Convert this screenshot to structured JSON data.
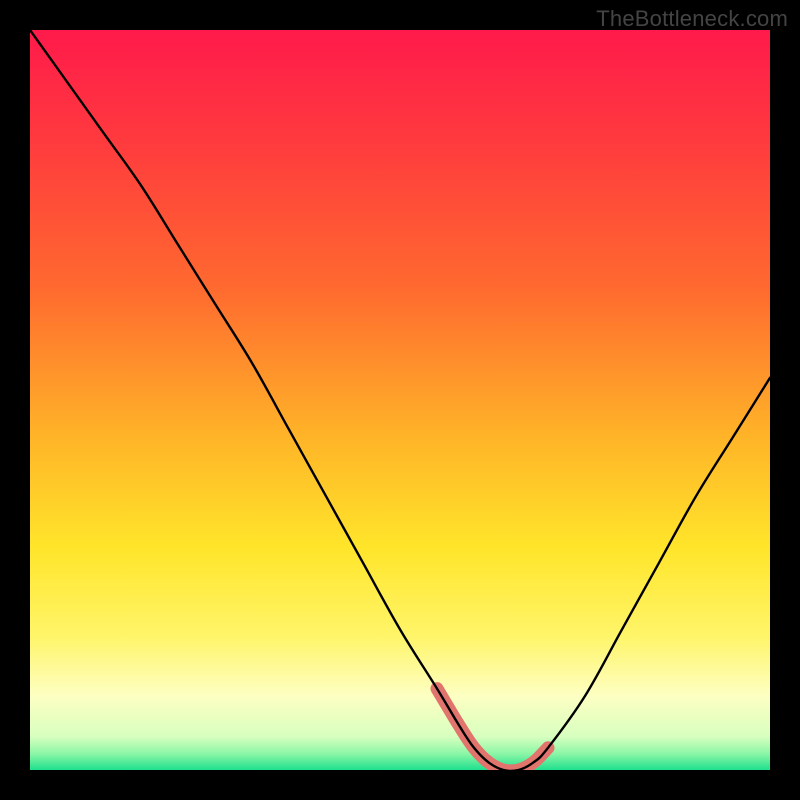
{
  "watermark": "TheBottleneck.com",
  "colors": {
    "frame": "#000000",
    "curve": "#000000",
    "highlight": "#e2746e",
    "gradient_stops": [
      {
        "offset": 0.0,
        "color": "#ff1a4b"
      },
      {
        "offset": 0.15,
        "color": "#ff3a3e"
      },
      {
        "offset": 0.35,
        "color": "#ff6a2f"
      },
      {
        "offset": 0.55,
        "color": "#ffb428"
      },
      {
        "offset": 0.7,
        "color": "#ffe52a"
      },
      {
        "offset": 0.82,
        "color": "#fff56a"
      },
      {
        "offset": 0.9,
        "color": "#fdffc2"
      },
      {
        "offset": 0.955,
        "color": "#d7ffbf"
      },
      {
        "offset": 0.978,
        "color": "#8bf6a6"
      },
      {
        "offset": 1.0,
        "color": "#1fe08e"
      }
    ]
  },
  "chart_data": {
    "type": "line",
    "title": "",
    "xlabel": "",
    "ylabel": "",
    "xlim": [
      0,
      100
    ],
    "ylim": [
      0,
      100
    ],
    "grid": false,
    "legend": false,
    "series": [
      {
        "name": "bottleneck-curve",
        "x": [
          0,
          5,
          10,
          15,
          20,
          25,
          30,
          35,
          40,
          45,
          50,
          55,
          58,
          60,
          62,
          64,
          66,
          68,
          70,
          75,
          80,
          85,
          90,
          95,
          100
        ],
        "values": [
          100,
          93,
          86,
          79,
          71,
          63,
          55,
          46,
          37,
          28,
          19,
          11,
          6,
          3,
          1,
          0,
          0,
          1,
          3,
          10,
          19,
          28,
          37,
          45,
          53
        ]
      }
    ],
    "annotations": [
      {
        "name": "valley-highlight",
        "x": [
          55,
          58,
          60,
          62,
          64,
          66,
          68,
          70
        ],
        "values": [
          11,
          6,
          3,
          1,
          0,
          0,
          1,
          3
        ]
      }
    ]
  }
}
